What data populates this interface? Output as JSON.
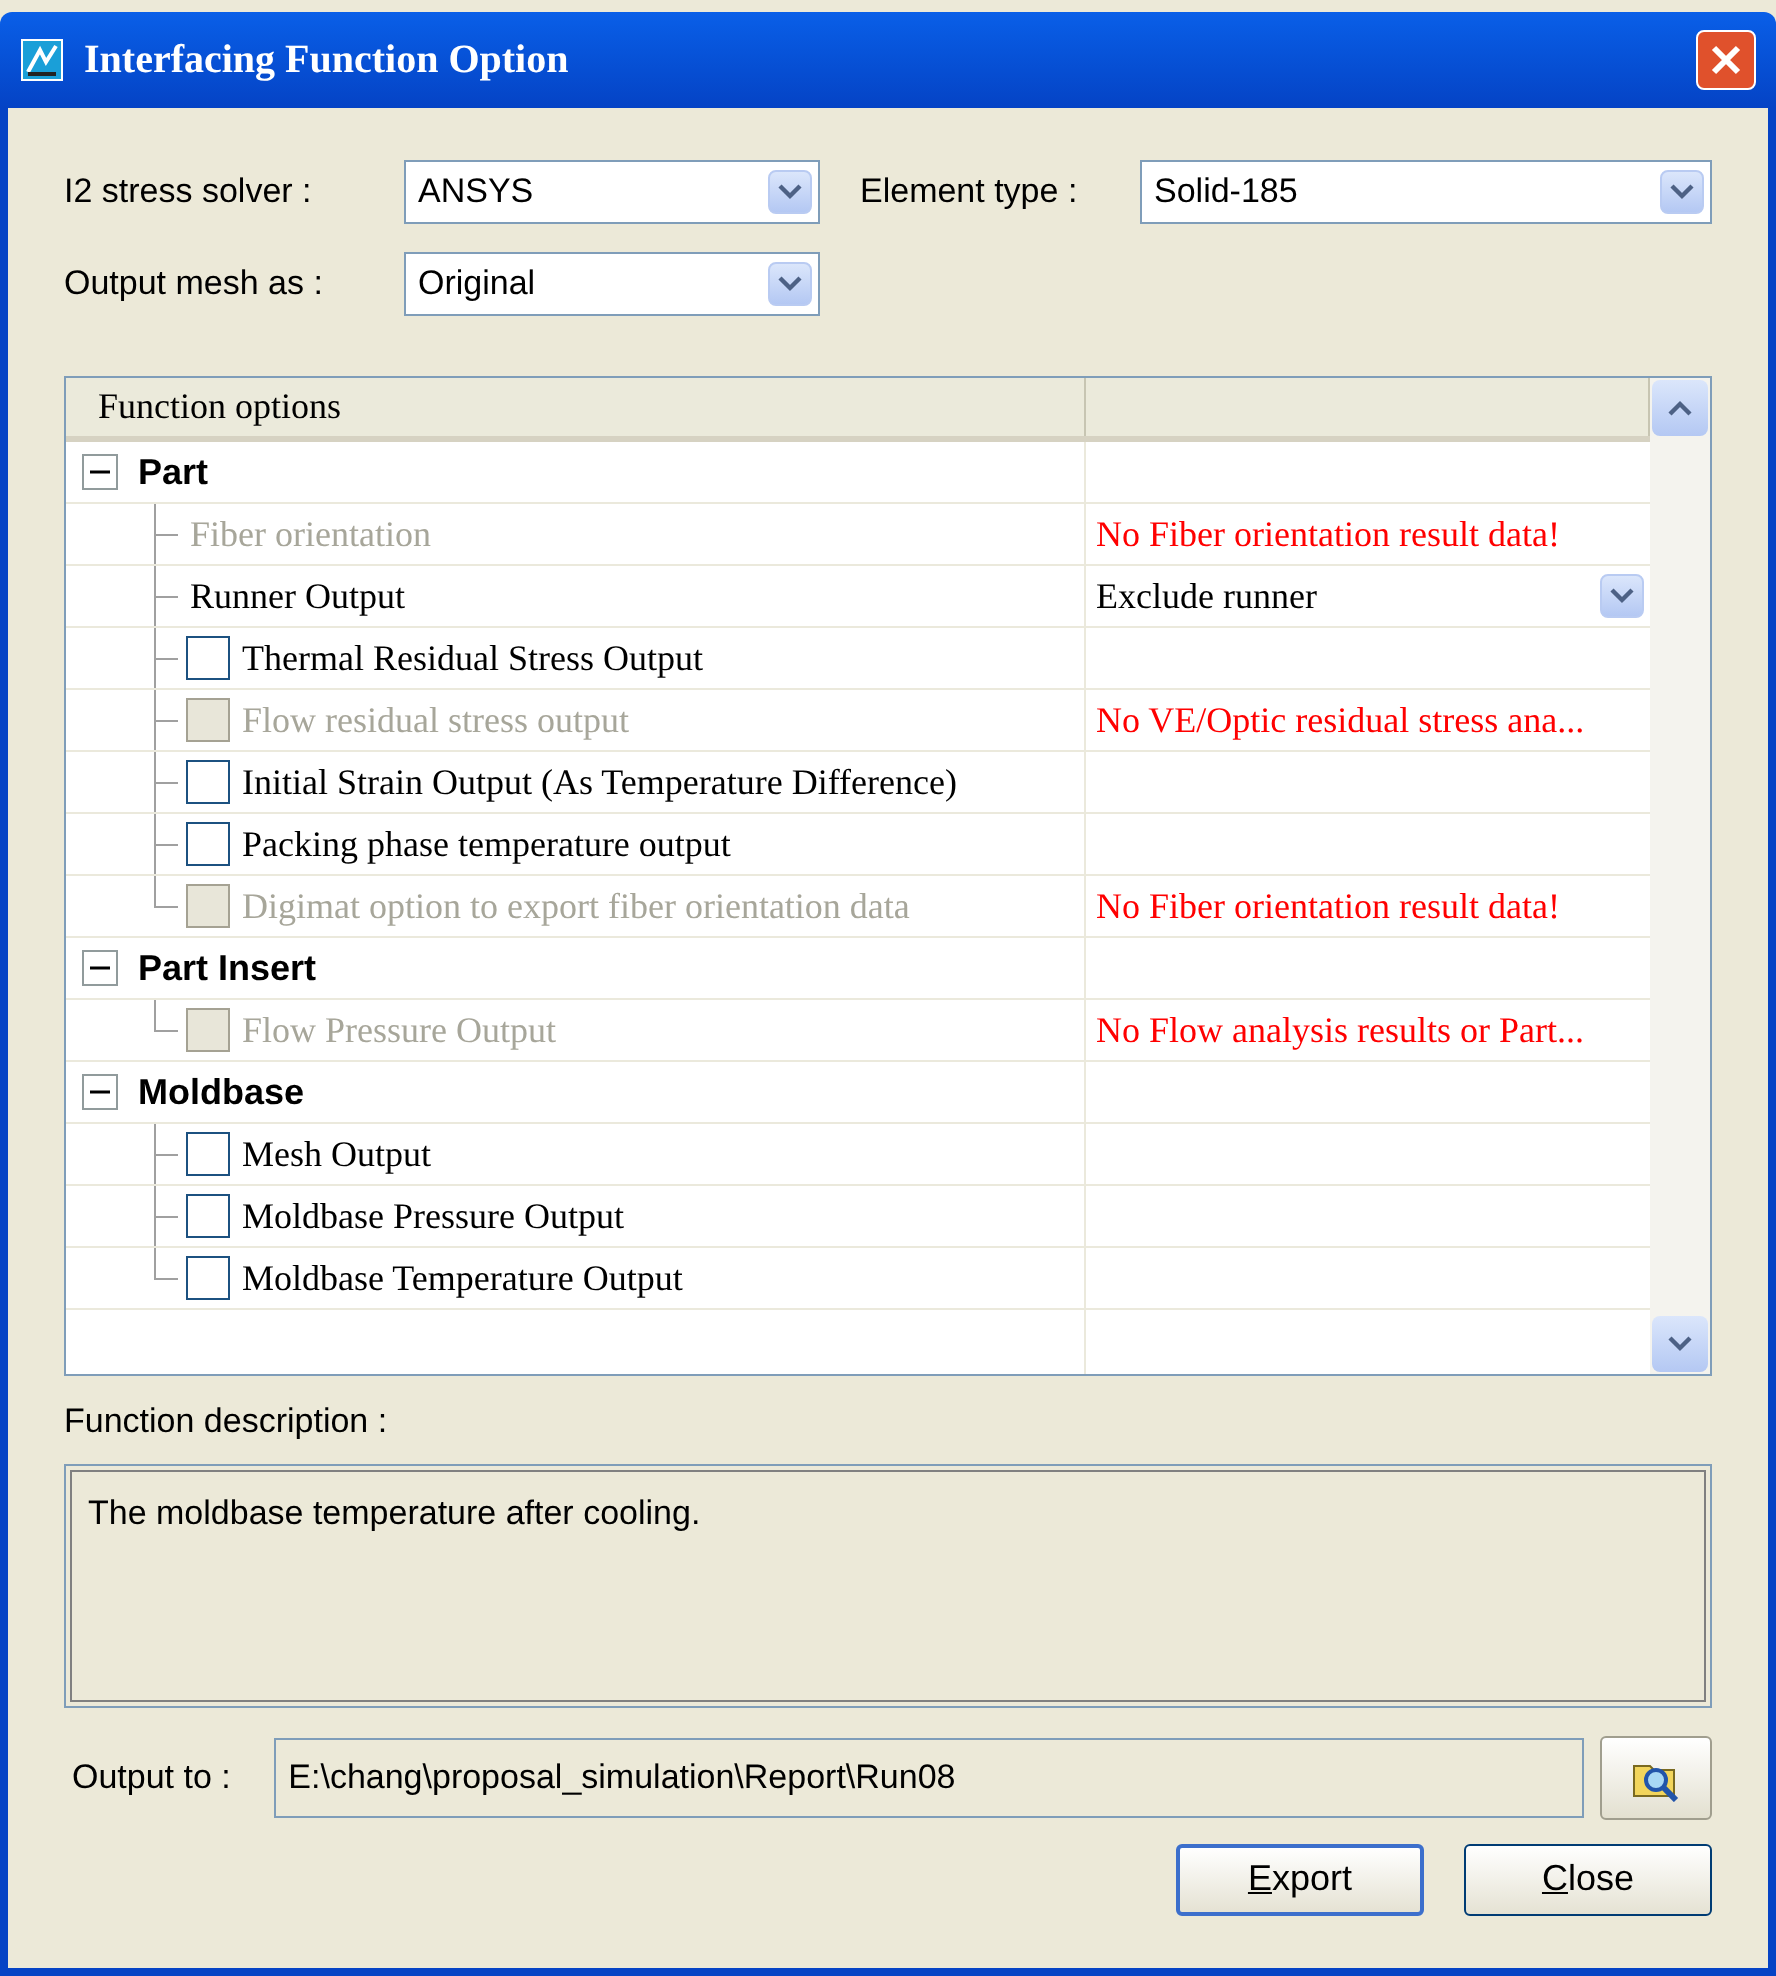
{
  "window": {
    "title": "Interfacing Function Option"
  },
  "settings": [
    {
      "label": "I2 stress solver :",
      "value": "ANSYS"
    },
    {
      "label": "Element type :",
      "value": "Solid-185"
    },
    {
      "label": "Output mesh as :",
      "value": "Original"
    }
  ],
  "tree": {
    "columns": [
      "Function options"
    ],
    "groups": [
      {
        "label": "Part",
        "expanded": true,
        "children": [
          {
            "kind": "text",
            "label": "Fiber orientation",
            "disabled": true,
            "note": "No Fiber orientation result data!"
          },
          {
            "kind": "dropdown",
            "label": "Runner Output",
            "disabled": false,
            "value": "Exclude runner"
          },
          {
            "kind": "checkbox",
            "label": "Thermal Residual Stress Output",
            "disabled": false,
            "checked": false
          },
          {
            "kind": "checkbox",
            "label": "Flow residual stress output",
            "disabled": true,
            "checked": false,
            "note": "No VE/Optic residual stress ana..."
          },
          {
            "kind": "checkbox",
            "label": "Initial Strain Output (As Temperature Difference)",
            "disabled": false,
            "checked": false
          },
          {
            "kind": "checkbox",
            "label": "Packing phase temperature output",
            "disabled": false,
            "checked": false
          },
          {
            "kind": "checkbox",
            "label": "Digimat option to export fiber orientation data",
            "disabled": true,
            "checked": false,
            "note": "No Fiber orientation result data!"
          }
        ]
      },
      {
        "label": "Part Insert",
        "expanded": true,
        "children": [
          {
            "kind": "checkbox",
            "label": "Flow Pressure Output",
            "disabled": true,
            "checked": false,
            "note": "No Flow analysis results or Part..."
          }
        ]
      },
      {
        "label": "Moldbase",
        "expanded": true,
        "children": [
          {
            "kind": "checkbox",
            "label": "Mesh Output",
            "disabled": false,
            "checked": false
          },
          {
            "kind": "checkbox",
            "label": "Moldbase Pressure Output",
            "disabled": false,
            "checked": false
          },
          {
            "kind": "checkbox",
            "label": "Moldbase Temperature Output",
            "disabled": false,
            "checked": false
          }
        ]
      }
    ]
  },
  "description": {
    "label": "Function description :",
    "text": "The moldbase temperature after cooling."
  },
  "output": {
    "label": "Output to :",
    "value": "E:\\chang\\proposal_simulation\\Report\\Run08"
  },
  "buttons": [
    {
      "label": "Export",
      "first_letter_underlined": true,
      "default": true
    },
    {
      "label": "Close",
      "first_letter_underlined": true,
      "default": false
    }
  ]
}
